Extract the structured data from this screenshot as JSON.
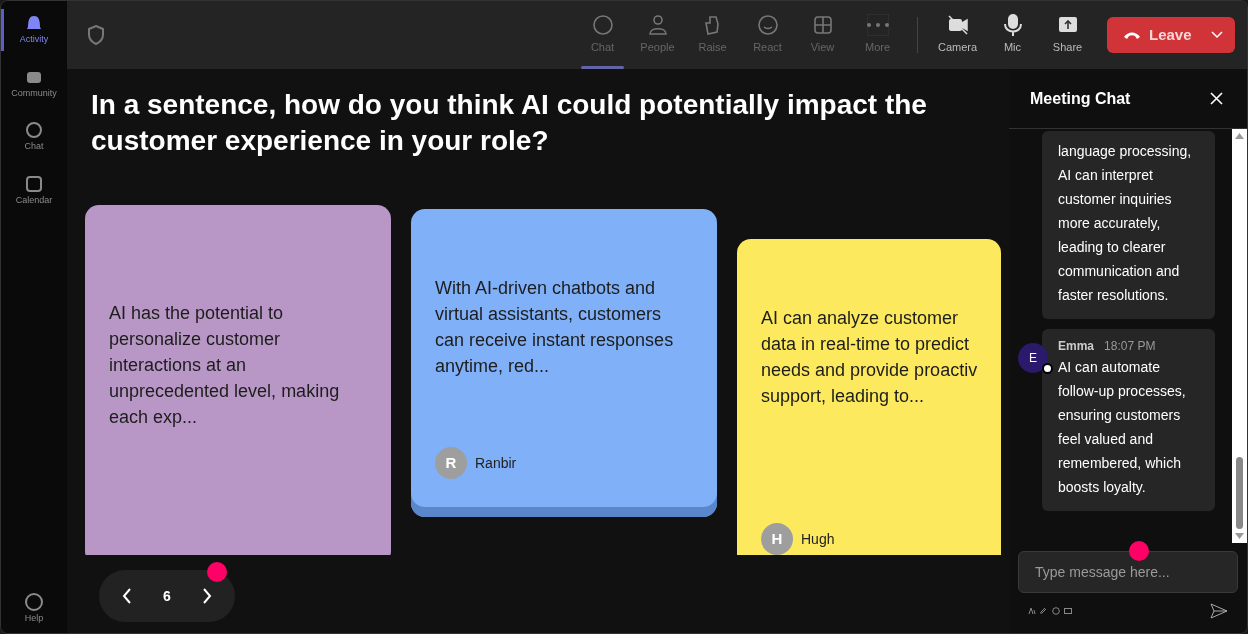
{
  "rail": [
    {
      "label": "Activity",
      "selected": true
    },
    {
      "label": "Community",
      "selected": false
    },
    {
      "label": "Chat",
      "selected": false
    },
    {
      "label": "Calendar",
      "selected": false
    }
  ],
  "rail_bottom": {
    "label": "Help"
  },
  "toolbar": [
    {
      "kind": "chat",
      "label": "Chat",
      "selected": true
    },
    {
      "kind": "people",
      "label": "People",
      "selected": false
    },
    {
      "kind": "raise",
      "label": "Raise",
      "selected": false
    },
    {
      "kind": "react",
      "label": "React",
      "selected": false
    },
    {
      "kind": "view",
      "label": "View",
      "selected": false
    },
    {
      "kind": "more",
      "label": "More",
      "selected": false
    },
    {
      "kind": "camera",
      "label": "Camera",
      "selected": false
    },
    {
      "kind": "mic",
      "label": "Mic",
      "selected": false
    },
    {
      "kind": "share",
      "label": "Share",
      "selected": false
    }
  ],
  "leave_button": {
    "label": "Leave"
  },
  "question": "In a sentence, how do you think AI could potentially impact the customer experience in your role?",
  "cards": [
    {
      "color": "#b897c6",
      "text": "AI has the potential to personalize customer interactions at an unprecedented level, making each exp..."
    },
    {
      "color": "#7fb0f8",
      "text": "With AI-driven chatbots and virtual assistants, customers can receive instant responses anytime, red...",
      "author": "Ranbir",
      "initial": "R"
    },
    {
      "color": "#fde95d",
      "text": "AI can analyze customer data in real-time to predict needs and provide proactiv support, leading to...",
      "author": "Hugh",
      "initial": "H"
    }
  ],
  "pager": {
    "page": "6"
  },
  "chat": {
    "title": "Meeting Chat",
    "messages": [
      {
        "text": "language processing, AI can interpret customer inquiries more accurately, leading to clearer communication and faster resolutions."
      },
      {
        "author": "Emma",
        "time": "18:07 PM",
        "initial": "E",
        "text": "AI can automate follow-up processes, ensuring customers feel valued and remembered, which boosts loyalty."
      }
    ],
    "placeholder": "Type message here..."
  }
}
